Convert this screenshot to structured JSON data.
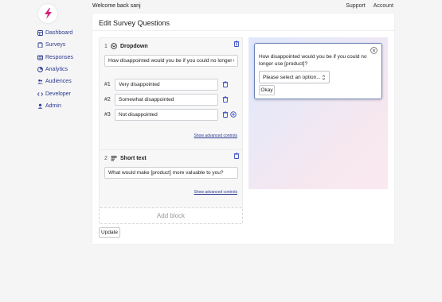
{
  "nav": {
    "items": [
      {
        "label": "Dashboard",
        "icon": "dashboard-icon"
      },
      {
        "label": "Surveys",
        "icon": "clipboard-icon"
      },
      {
        "label": "Responses",
        "icon": "inbox-icon"
      },
      {
        "label": "Analytics",
        "icon": "chart-icon"
      },
      {
        "label": "Audiences",
        "icon": "users-icon"
      },
      {
        "label": "Developer",
        "icon": "code-icon"
      },
      {
        "label": "Admin",
        "icon": "admin-icon"
      }
    ]
  },
  "header": {
    "welcome": "Welcome back sanj",
    "support": "Support",
    "account": "Account"
  },
  "editor": {
    "title": "Edit Survey Questions",
    "blocks": [
      {
        "number": "1",
        "type": "Dropdown",
        "question": "How disappointed would you be if you could no longer u",
        "options": [
          {
            "label": "#1",
            "value": "Very disappointed"
          },
          {
            "label": "#2",
            "value": "Somewhat disappointed"
          },
          {
            "label": "#3",
            "value": "Not disappointed"
          }
        ],
        "advanced": "Show advanced controls"
      },
      {
        "number": "2",
        "type": "Short text",
        "question": "What would make [product] more valuable to you?",
        "advanced": "Show advanced controls"
      }
    ],
    "add_block": "Add block",
    "update": "Update"
  },
  "preview": {
    "question": "How disappointed would you be if you could no longer use [product]?",
    "select_placeholder": "Please select an option...",
    "okay": "Okay"
  },
  "colors": {
    "accent": "#2b3a8f",
    "logo": "#d4237a",
    "trash": "#3b4fc4"
  }
}
